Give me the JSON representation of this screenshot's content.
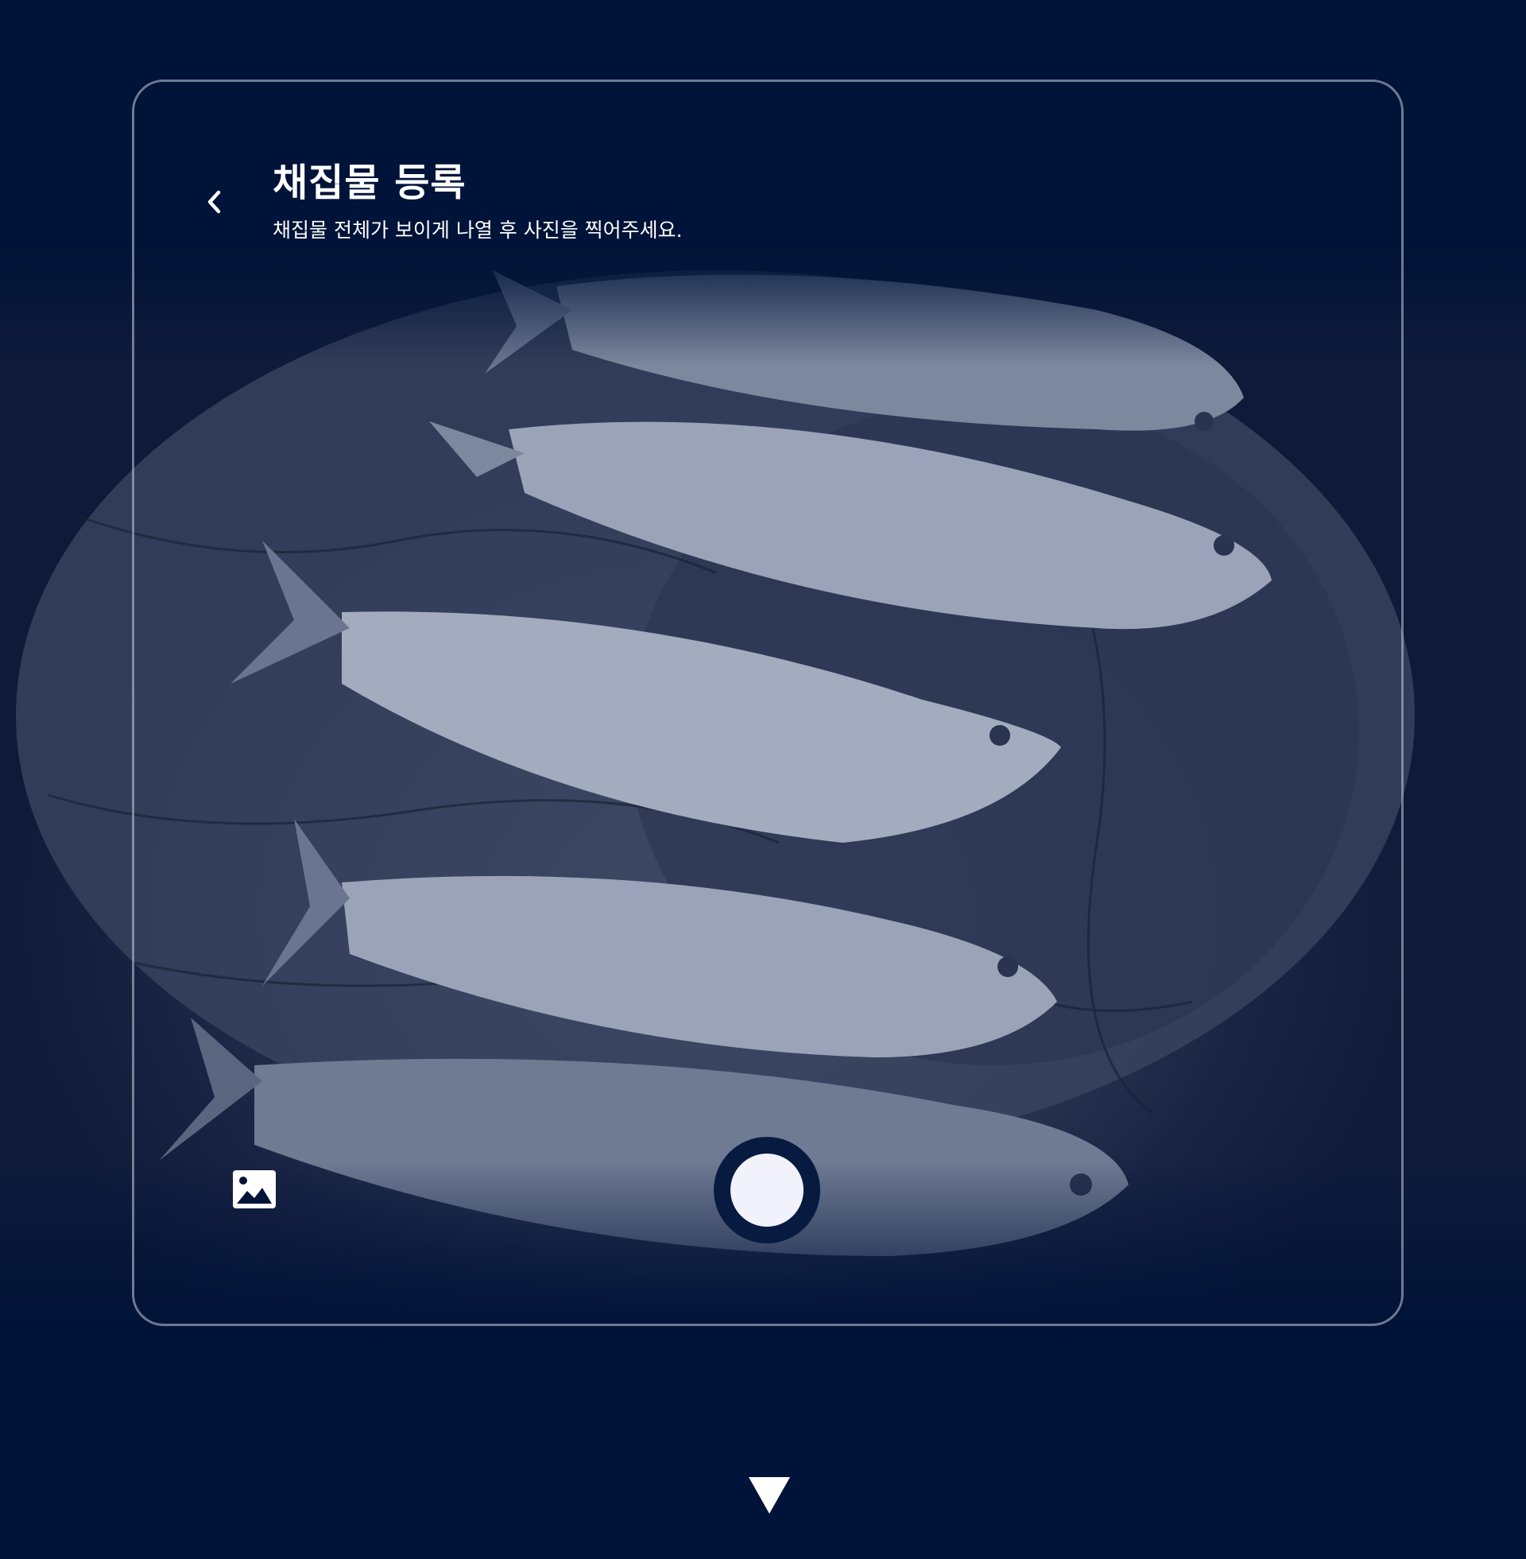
{
  "header": {
    "title": "채집물 등록",
    "subtitle": "채집물 전체가 보이게 나열 후 사진을 찍어주세요."
  },
  "icons": {
    "back": "chevron-left-icon",
    "gallery": "image-icon",
    "shutter": "shutter-button",
    "down": "triangle-down-icon"
  },
  "colors": {
    "background": "#001338",
    "frame_border": "#c8cedc",
    "shutter_fill": "#f1f2fb",
    "text": "#ffffff"
  },
  "preview": {
    "subject": "fish"
  }
}
